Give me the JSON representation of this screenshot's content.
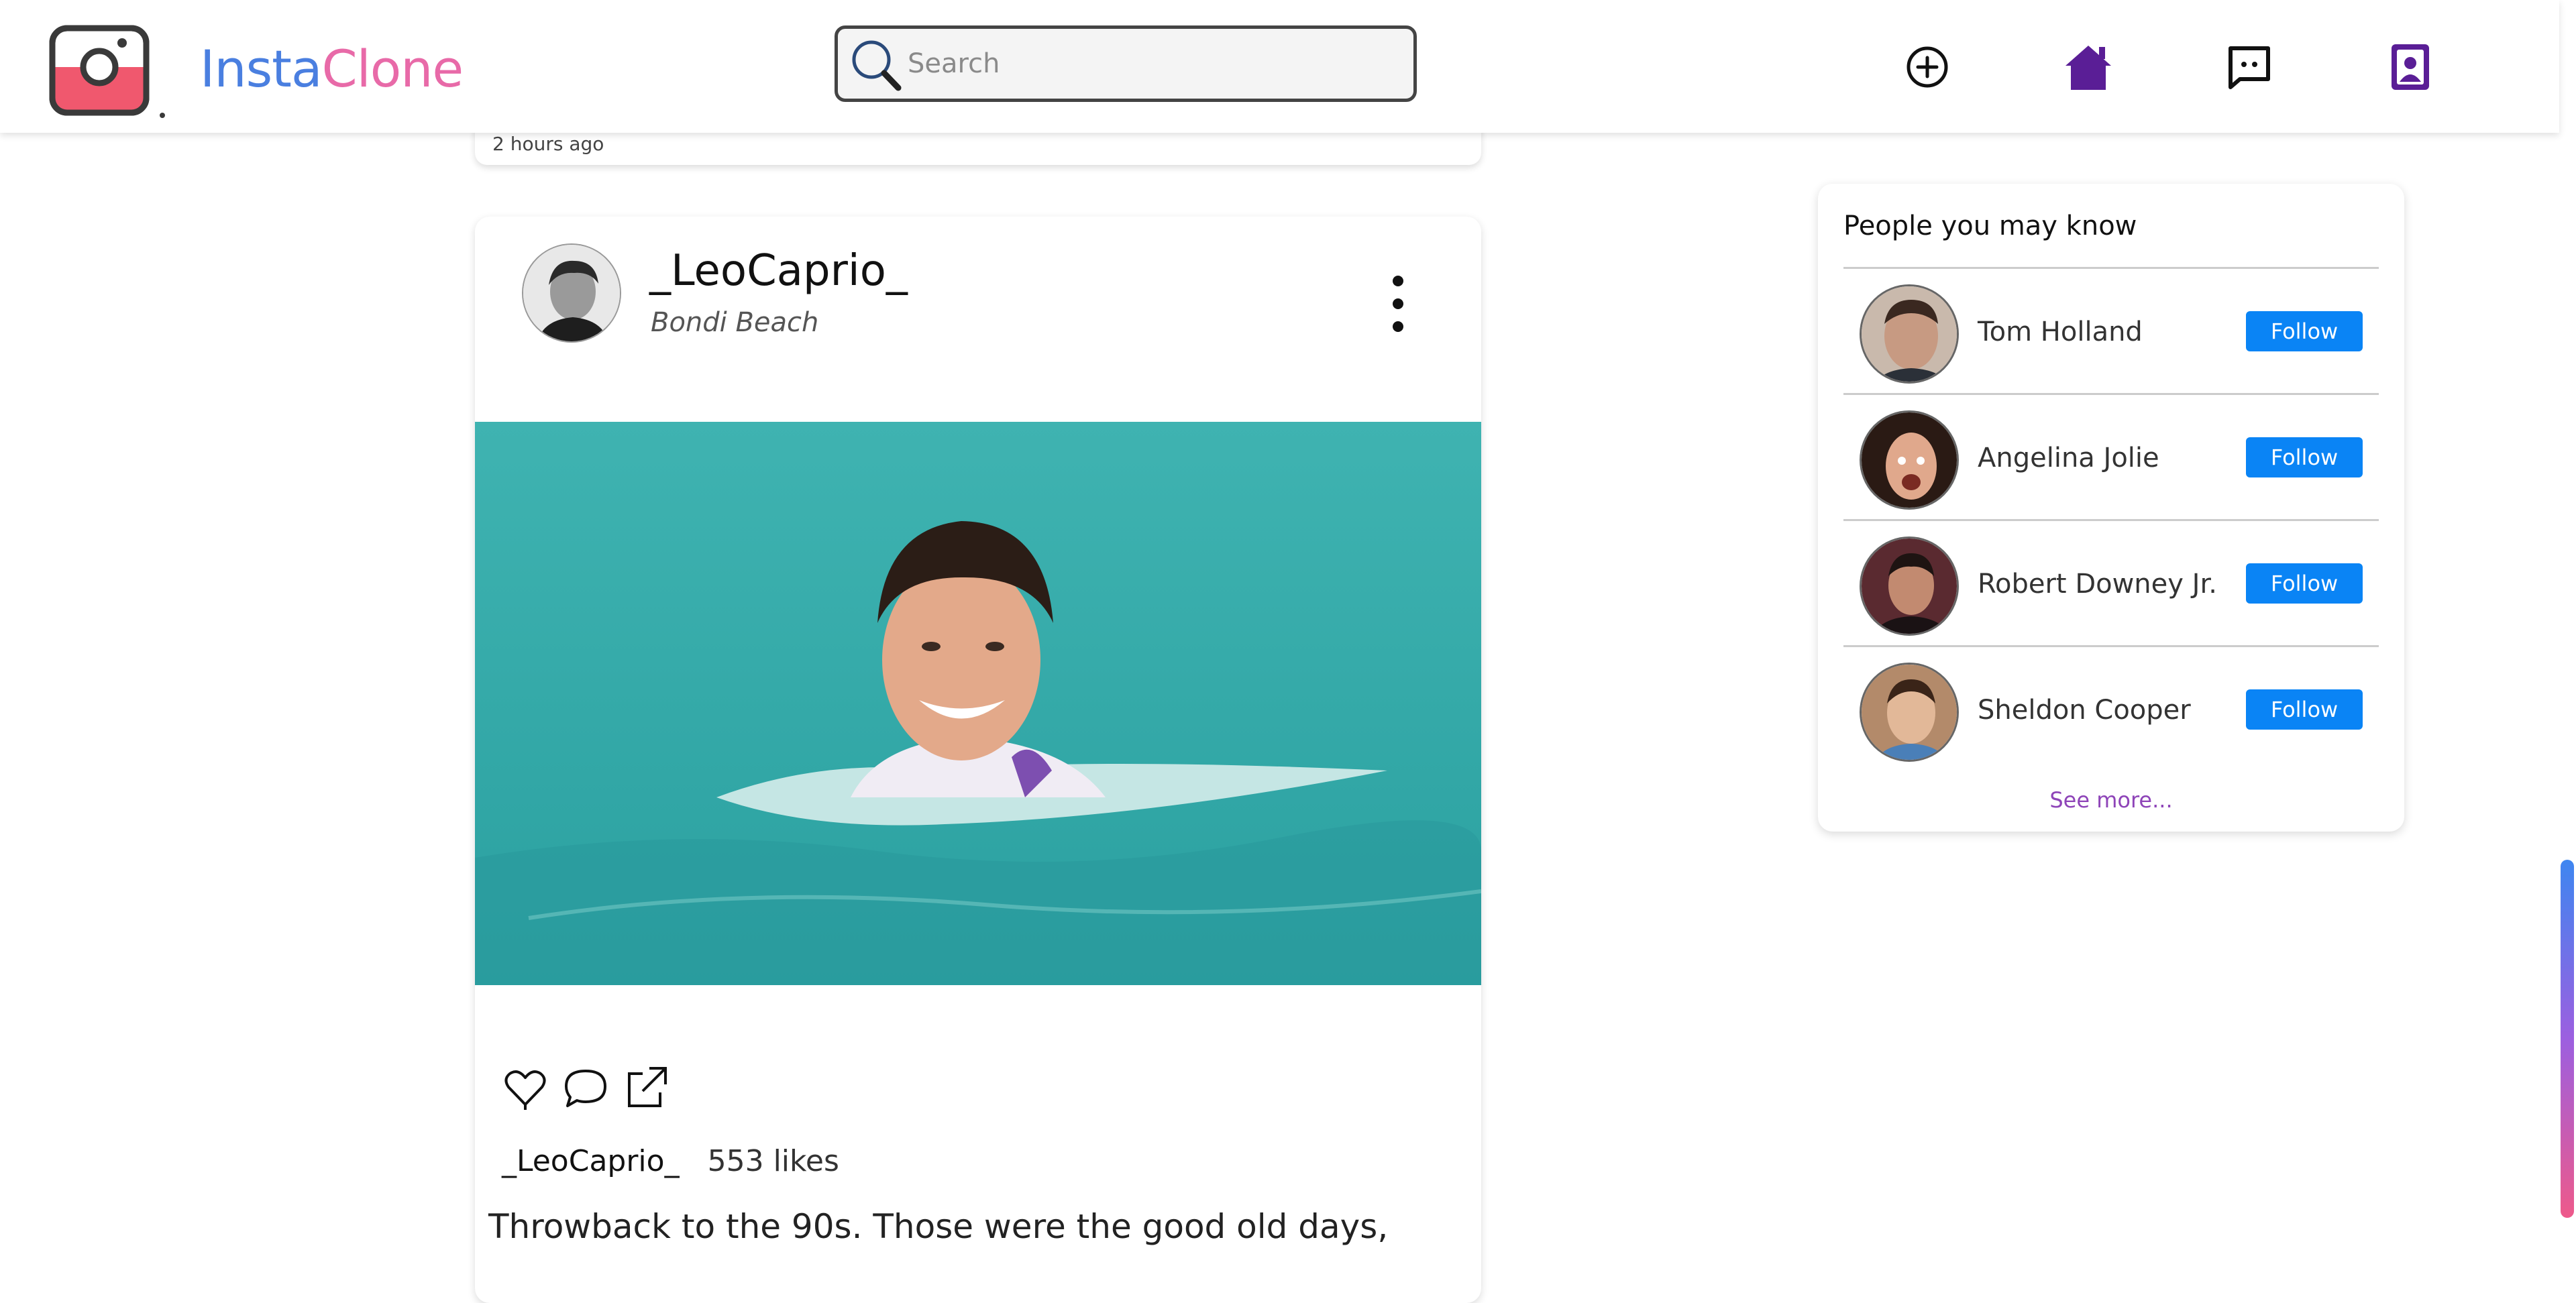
{
  "brand": {
    "part1": "Insta",
    "part2": "Clone"
  },
  "search": {
    "placeholder": "Search",
    "value": ""
  },
  "nav": {
    "icons": [
      "plus-circle-icon",
      "home-icon",
      "chat-icon",
      "profile-icon"
    ],
    "active_color": "#5a1e96"
  },
  "previous_post": {
    "time": "2 hours ago"
  },
  "post": {
    "username": "_LeoCaprio_",
    "location": "Bondi Beach",
    "likes_username": "_LeoCaprio_",
    "likes": "553 likes",
    "caption": "Throwback to the 90s. Those were the good old days,"
  },
  "sidebar": {
    "title": "People you may know",
    "people": [
      {
        "name": "Tom Holland",
        "button": "Follow"
      },
      {
        "name": "Angelina Jolie",
        "button": "Follow"
      },
      {
        "name": "Robert Downey Jr.",
        "button": "Follow"
      },
      {
        "name": "Sheldon Cooper",
        "button": "Follow"
      }
    ],
    "see_more": "See more..."
  },
  "colors": {
    "accent": "#0a84f5",
    "brand_blue": "#4a7fe0",
    "brand_pink": "#e86aa8",
    "link_purple": "#8e44b8"
  }
}
